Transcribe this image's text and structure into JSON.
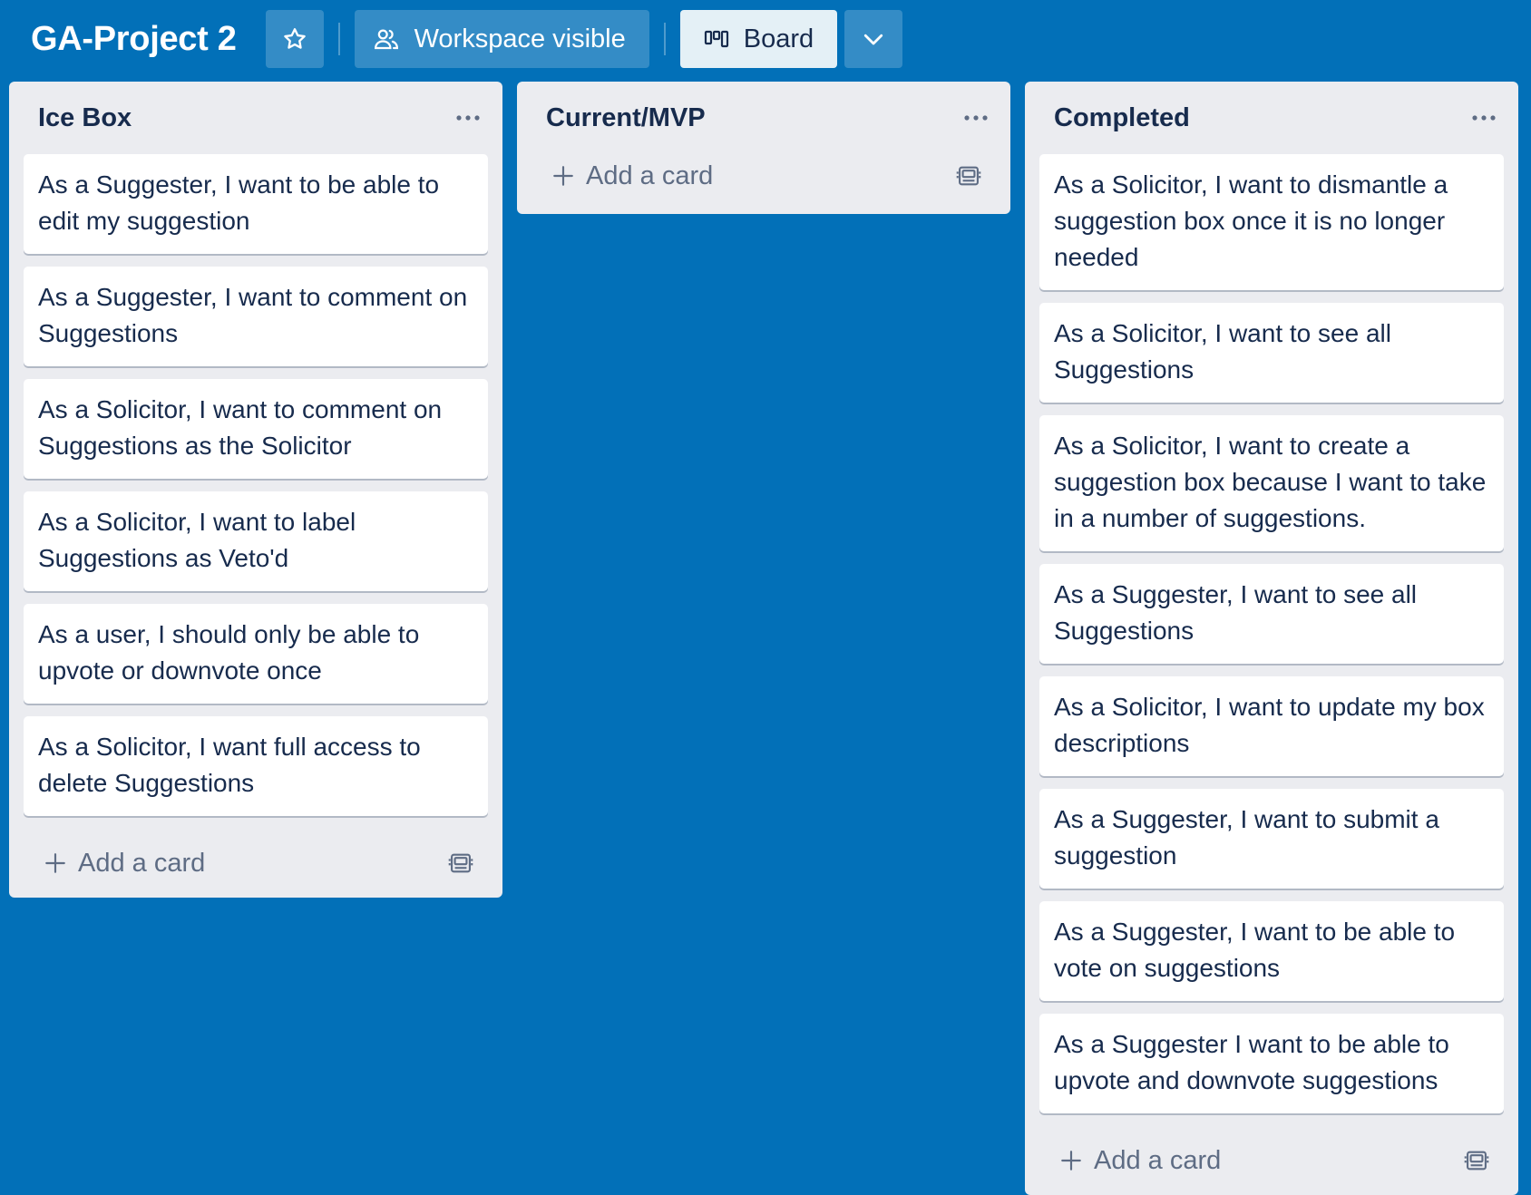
{
  "header": {
    "board_title": "GA-Project 2",
    "visibility_label": "Workspace visible",
    "view_label": "Board"
  },
  "lists": [
    {
      "title": "Ice Box",
      "cards": [
        "As a Suggester, I want to be able to edit my suggestion",
        "As a Suggester, I want to comment on Suggestions",
        "As a Solicitor, I want to comment on Suggestions as the Solicitor",
        "As a Solicitor, I want to label Suggestions as Veto'd",
        "As a user, I should only be able to upvote or downvote once",
        "As a Solicitor, I want full access to delete Suggestions"
      ],
      "add_label": "Add a card"
    },
    {
      "title": "Current/MVP",
      "cards": [],
      "add_label": "Add a card"
    },
    {
      "title": "Completed",
      "cards": [
        "As a Solicitor, I want to dismantle a suggestion box once it is no longer needed",
        "As a Solicitor, I want to see all Suggestions",
        "As a Solicitor, I want to create a suggestion box because I want to take in a number of suggestions.",
        "As a Suggester, I want to see all Suggestions",
        "As a Solicitor, I want to update my box descriptions",
        "As a Suggester, I want to submit a suggestion",
        "As a Suggester, I want to be able to vote on suggestions",
        "As a Suggester I want to be able to upvote and downvote suggestions"
      ],
      "add_label": "Add a card"
    }
  ],
  "icons": {
    "star": "star-icon",
    "visibility": "people-icon",
    "view": "board-icon",
    "chevron": "chevron-down-icon",
    "list_menu": "more-horizontal-icon",
    "add": "plus-icon",
    "template": "card-template-icon"
  }
}
